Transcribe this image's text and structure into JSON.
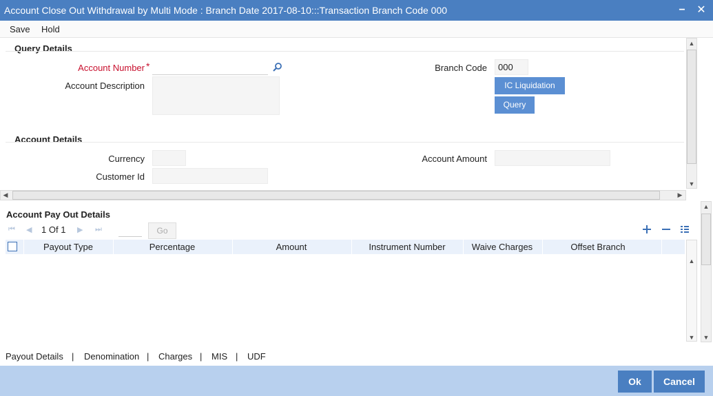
{
  "window": {
    "title": "Account Close Out Withdrawal by Multi Mode : Branch Date 2017-08-10:::Transaction Branch Code 000",
    "minimize_glyph": "−",
    "close_glyph": "✕"
  },
  "menu": {
    "save": "Save",
    "hold": "Hold"
  },
  "query_details": {
    "title": "Query Details",
    "account_number_label": "Account Number",
    "required_mark": "*",
    "account_number_value": "",
    "account_description_label": "Account Description",
    "account_description_value": "",
    "branch_code_label": "Branch Code",
    "branch_code_value": "000",
    "ic_liquidation_button": "IC Liquidation",
    "query_button": "Query"
  },
  "account_details": {
    "title": "Account Details",
    "currency_label": "Currency",
    "currency_value": "",
    "account_amount_label": "Account Amount",
    "account_amount_value": "",
    "customer_id_label": "Customer Id",
    "customer_id_value": ""
  },
  "payout": {
    "title": "Account Pay Out Details",
    "page_current": "1",
    "page_of": "Of",
    "page_total": "1",
    "go_button": "Go",
    "columns": [
      "Payout Type",
      "Percentage",
      "Amount",
      "Instrument Number",
      "Waive Charges",
      "Offset Branch"
    ],
    "rows": []
  },
  "bottom_tabs": [
    "Payout Details",
    "|",
    "Denomination",
    "|",
    "Charges",
    "|",
    "MIS",
    "|",
    "UDF"
  ],
  "footer": {
    "ok": "Ok",
    "cancel": "Cancel"
  },
  "icons": {
    "search": "search-icon",
    "add": "plus-icon",
    "delete": "minus-icon",
    "view": "list-icon",
    "first": "first-page-icon",
    "prev": "prev-page-icon",
    "next": "next-page-icon",
    "last": "last-page-icon"
  },
  "colors": {
    "titlebar": "#4a7fc1",
    "button": "#5b8fd3",
    "required": "#c8102e",
    "footer": "#b8d0ee"
  }
}
